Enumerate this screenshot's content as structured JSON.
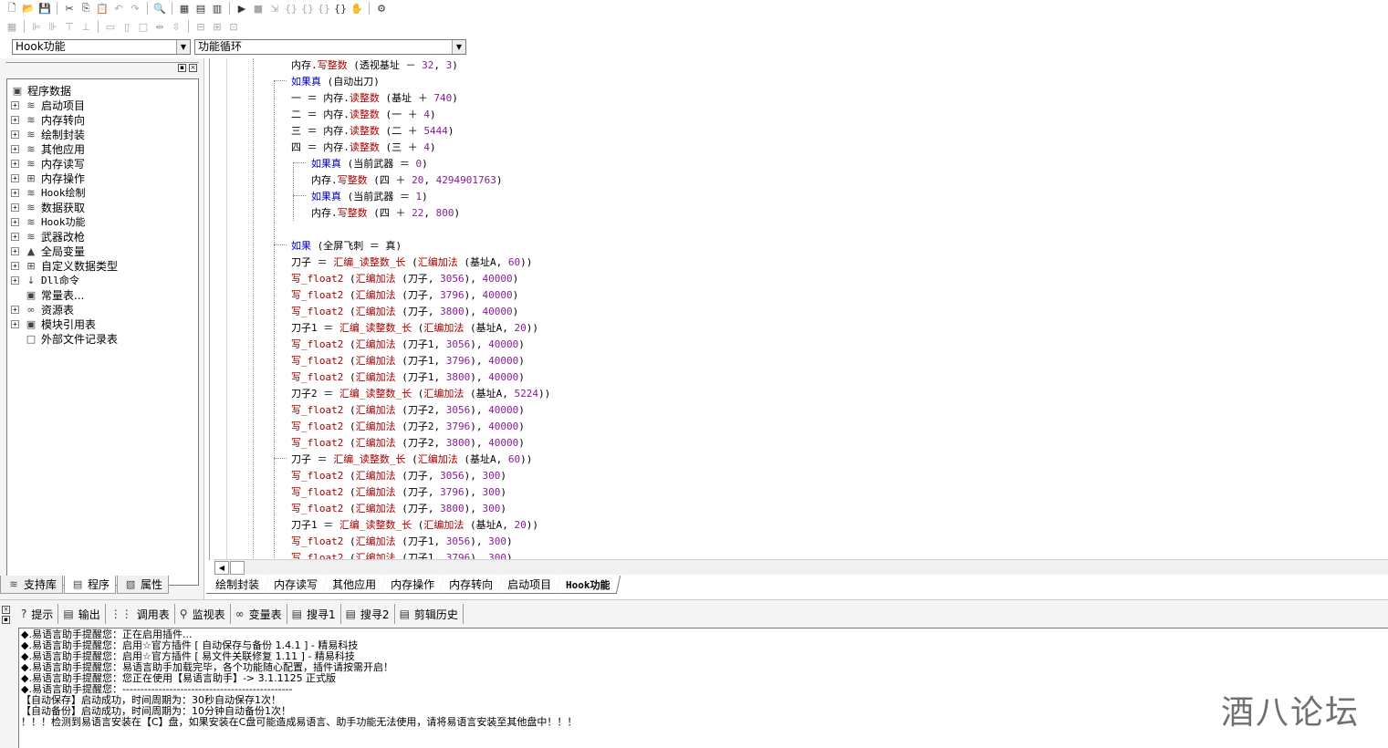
{
  "toolbar1": {
    "icons": [
      "new-file-icon",
      "open-folder-icon",
      "save-icon",
      "cut-icon",
      "copy-icon",
      "paste-icon",
      "undo-icon",
      "redo-icon",
      "find-icon",
      "layout1-icon",
      "layout2-icon",
      "layout3-icon",
      "run-icon",
      "stop-icon",
      "step-icon",
      "step-into-icon",
      "step-over-icon",
      "step-out-icon",
      "hand-icon",
      "plugin-icon"
    ]
  },
  "combos": {
    "left_value": "Hook功能",
    "right_value": "功能循环"
  },
  "tree": {
    "root": "程序数据",
    "items": [
      {
        "label": "启动项目",
        "expander": "+"
      },
      {
        "label": "内存转向",
        "expander": "+"
      },
      {
        "label": "绘制封装",
        "expander": "+"
      },
      {
        "label": "其他应用",
        "expander": "+"
      },
      {
        "label": "内存读写",
        "expander": "+"
      },
      {
        "label": "内存操作",
        "expander": "+"
      },
      {
        "label": "Hook绘制",
        "expander": "+"
      },
      {
        "label": "数据获取",
        "expander": "+"
      },
      {
        "label": "Hook功能",
        "expander": "+"
      },
      {
        "label": "武器改枪",
        "expander": "+"
      },
      {
        "label": "全局变量",
        "expander": "+"
      },
      {
        "label": "自定义数据类型",
        "expander": "+"
      },
      {
        "label": "Dll命令",
        "expander": "+"
      },
      {
        "label": "常量表...",
        "expander": ""
      },
      {
        "label": "资源表",
        "expander": "+"
      },
      {
        "label": "模块引用表",
        "expander": "+"
      },
      {
        "label": "外部文件记录表",
        "expander": ""
      }
    ]
  },
  "left_tabs": [
    {
      "label": "支持库"
    },
    {
      "label": "程序"
    },
    {
      "label": "属性"
    }
  ],
  "code": {
    "lines": [
      {
        "indent": 0,
        "parts": [
          [
            "var",
            "内存"
          ],
          [
            "var",
            "."
          ],
          [
            "fn",
            "写整数"
          ],
          [
            "var",
            " (透视基址 "
          ],
          [
            "var",
            "－"
          ],
          [
            "num",
            " 32"
          ],
          [
            "var",
            ", "
          ],
          [
            "num",
            "3"
          ],
          [
            "var",
            ")"
          ]
        ]
      },
      {
        "indent": 0,
        "parts": [
          [
            "kw",
            "如果真"
          ],
          [
            "var",
            " (自动出刀)"
          ]
        ]
      },
      {
        "indent": 0,
        "parts": [
          [
            "var",
            "一 "
          ],
          [
            "var",
            "＝"
          ],
          [
            "var",
            " 内存"
          ],
          [
            "var",
            "."
          ],
          [
            "fn",
            "读整数"
          ],
          [
            "var",
            " (基址 "
          ],
          [
            "var",
            "＋"
          ],
          [
            "num",
            " 740"
          ],
          [
            "var",
            ")"
          ]
        ]
      },
      {
        "indent": 0,
        "parts": [
          [
            "var",
            "二 "
          ],
          [
            "var",
            "＝"
          ],
          [
            "var",
            " 内存"
          ],
          [
            "var",
            "."
          ],
          [
            "fn",
            "读整数"
          ],
          [
            "var",
            " (一 "
          ],
          [
            "var",
            "＋"
          ],
          [
            "num",
            " 4"
          ],
          [
            "var",
            ")"
          ]
        ]
      },
      {
        "indent": 0,
        "parts": [
          [
            "var",
            "三 "
          ],
          [
            "var",
            "＝"
          ],
          [
            "var",
            " 内存"
          ],
          [
            "var",
            "."
          ],
          [
            "fn",
            "读整数"
          ],
          [
            "var",
            " (二 "
          ],
          [
            "var",
            "＋"
          ],
          [
            "num",
            " 5444"
          ],
          [
            "var",
            ")"
          ]
        ]
      },
      {
        "indent": 0,
        "parts": [
          [
            "var",
            "四 "
          ],
          [
            "var",
            "＝"
          ],
          [
            "var",
            " 内存"
          ],
          [
            "var",
            "."
          ],
          [
            "fn",
            "读整数"
          ],
          [
            "var",
            " (三 "
          ],
          [
            "var",
            "＋"
          ],
          [
            "num",
            " 4"
          ],
          [
            "var",
            ")"
          ]
        ]
      },
      {
        "indent": 1,
        "parts": [
          [
            "kw",
            "如果真"
          ],
          [
            "var",
            " (当前武器 "
          ],
          [
            "var",
            "＝"
          ],
          [
            "num",
            " 0"
          ],
          [
            "var",
            ")"
          ]
        ]
      },
      {
        "indent": 1,
        "parts": [
          [
            "var",
            "内存"
          ],
          [
            "var",
            "."
          ],
          [
            "fn",
            "写整数"
          ],
          [
            "var",
            " (四 "
          ],
          [
            "var",
            "＋"
          ],
          [
            "num",
            " 20"
          ],
          [
            "var",
            ", "
          ],
          [
            "num",
            "4294901763"
          ],
          [
            "var",
            ")"
          ]
        ]
      },
      {
        "indent": 1,
        "parts": [
          [
            "kw",
            "如果真"
          ],
          [
            "var",
            " (当前武器 "
          ],
          [
            "var",
            "＝"
          ],
          [
            "num",
            " 1"
          ],
          [
            "var",
            ")"
          ]
        ]
      },
      {
        "indent": 1,
        "parts": [
          [
            "var",
            "内存"
          ],
          [
            "var",
            "."
          ],
          [
            "fn",
            "写整数"
          ],
          [
            "var",
            " (四 "
          ],
          [
            "var",
            "＋"
          ],
          [
            "num",
            " 22"
          ],
          [
            "var",
            ", "
          ],
          [
            "num",
            "800"
          ],
          [
            "var",
            ")"
          ]
        ]
      },
      {
        "indent": 0,
        "parts": []
      },
      {
        "indent": 0,
        "parts": [
          [
            "kw",
            "如果"
          ],
          [
            "var",
            " (全屏飞刺 "
          ],
          [
            "var",
            "＝"
          ],
          [
            "var",
            " 真)"
          ]
        ]
      },
      {
        "indent": 0,
        "parts": [
          [
            "var",
            "刀子 "
          ],
          [
            "var",
            "＝"
          ],
          [
            "fn",
            " 汇编_读整数_长"
          ],
          [
            "var",
            " ("
          ],
          [
            "fn",
            "汇编加法"
          ],
          [
            "var",
            " (基址A, "
          ],
          [
            "num",
            "60"
          ],
          [
            "var",
            "))"
          ]
        ]
      },
      {
        "indent": 0,
        "parts": [
          [
            "fn",
            "写_float2"
          ],
          [
            "var",
            " ("
          ],
          [
            "fn",
            "汇编加法"
          ],
          [
            "var",
            " (刀子, "
          ],
          [
            "num",
            "3056"
          ],
          [
            "var",
            "), "
          ],
          [
            "num",
            "40000"
          ],
          [
            "var",
            ")"
          ]
        ]
      },
      {
        "indent": 0,
        "parts": [
          [
            "fn",
            "写_float2"
          ],
          [
            "var",
            " ("
          ],
          [
            "fn",
            "汇编加法"
          ],
          [
            "var",
            " (刀子, "
          ],
          [
            "num",
            "3796"
          ],
          [
            "var",
            "), "
          ],
          [
            "num",
            "40000"
          ],
          [
            "var",
            ")"
          ]
        ]
      },
      {
        "indent": 0,
        "parts": [
          [
            "fn",
            "写_float2"
          ],
          [
            "var",
            " ("
          ],
          [
            "fn",
            "汇编加法"
          ],
          [
            "var",
            " (刀子, "
          ],
          [
            "num",
            "3800"
          ],
          [
            "var",
            "), "
          ],
          [
            "num",
            "40000"
          ],
          [
            "var",
            ")"
          ]
        ]
      },
      {
        "indent": 0,
        "parts": [
          [
            "var",
            "刀子1 "
          ],
          [
            "var",
            "＝"
          ],
          [
            "fn",
            " 汇编_读整数_长"
          ],
          [
            "var",
            " ("
          ],
          [
            "fn",
            "汇编加法"
          ],
          [
            "var",
            " (基址A, "
          ],
          [
            "num",
            "20"
          ],
          [
            "var",
            "))"
          ]
        ]
      },
      {
        "indent": 0,
        "parts": [
          [
            "fn",
            "写_float2"
          ],
          [
            "var",
            " ("
          ],
          [
            "fn",
            "汇编加法"
          ],
          [
            "var",
            " (刀子1, "
          ],
          [
            "num",
            "3056"
          ],
          [
            "var",
            "), "
          ],
          [
            "num",
            "40000"
          ],
          [
            "var",
            ")"
          ]
        ]
      },
      {
        "indent": 0,
        "parts": [
          [
            "fn",
            "写_float2"
          ],
          [
            "var",
            " ("
          ],
          [
            "fn",
            "汇编加法"
          ],
          [
            "var",
            " (刀子1, "
          ],
          [
            "num",
            "3796"
          ],
          [
            "var",
            "), "
          ],
          [
            "num",
            "40000"
          ],
          [
            "var",
            ")"
          ]
        ]
      },
      {
        "indent": 0,
        "parts": [
          [
            "fn",
            "写_float2"
          ],
          [
            "var",
            " ("
          ],
          [
            "fn",
            "汇编加法"
          ],
          [
            "var",
            " (刀子1, "
          ],
          [
            "num",
            "3800"
          ],
          [
            "var",
            "), "
          ],
          [
            "num",
            "40000"
          ],
          [
            "var",
            ")"
          ]
        ]
      },
      {
        "indent": 0,
        "parts": [
          [
            "var",
            "刀子2 "
          ],
          [
            "var",
            "＝"
          ],
          [
            "fn",
            " 汇编_读整数_长"
          ],
          [
            "var",
            " ("
          ],
          [
            "fn",
            "汇编加法"
          ],
          [
            "var",
            " (基址A, "
          ],
          [
            "num",
            "5224"
          ],
          [
            "var",
            "))"
          ]
        ]
      },
      {
        "indent": 0,
        "parts": [
          [
            "fn",
            "写_float2"
          ],
          [
            "var",
            " ("
          ],
          [
            "fn",
            "汇编加法"
          ],
          [
            "var",
            " (刀子2, "
          ],
          [
            "num",
            "3056"
          ],
          [
            "var",
            "), "
          ],
          [
            "num",
            "40000"
          ],
          [
            "var",
            ")"
          ]
        ]
      },
      {
        "indent": 0,
        "parts": [
          [
            "fn",
            "写_float2"
          ],
          [
            "var",
            " ("
          ],
          [
            "fn",
            "汇编加法"
          ],
          [
            "var",
            " (刀子2, "
          ],
          [
            "num",
            "3796"
          ],
          [
            "var",
            "), "
          ],
          [
            "num",
            "40000"
          ],
          [
            "var",
            ")"
          ]
        ]
      },
      {
        "indent": 0,
        "parts": [
          [
            "fn",
            "写_float2"
          ],
          [
            "var",
            " ("
          ],
          [
            "fn",
            "汇编加法"
          ],
          [
            "var",
            " (刀子2, "
          ],
          [
            "num",
            "3800"
          ],
          [
            "var",
            "), "
          ],
          [
            "num",
            "40000"
          ],
          [
            "var",
            ")"
          ]
        ]
      },
      {
        "indent": 0,
        "parts": [
          [
            "var",
            "刀子 "
          ],
          [
            "var",
            "＝"
          ],
          [
            "fn",
            " 汇编_读整数_长"
          ],
          [
            "var",
            " ("
          ],
          [
            "fn",
            "汇编加法"
          ],
          [
            "var",
            " (基址A, "
          ],
          [
            "num",
            "60"
          ],
          [
            "var",
            "))"
          ]
        ]
      },
      {
        "indent": 0,
        "parts": [
          [
            "fn",
            "写_float2"
          ],
          [
            "var",
            " ("
          ],
          [
            "fn",
            "汇编加法"
          ],
          [
            "var",
            " (刀子, "
          ],
          [
            "num",
            "3056"
          ],
          [
            "var",
            "), "
          ],
          [
            "num",
            "300"
          ],
          [
            "var",
            ")"
          ]
        ]
      },
      {
        "indent": 0,
        "parts": [
          [
            "fn",
            "写_float2"
          ],
          [
            "var",
            " ("
          ],
          [
            "fn",
            "汇编加法"
          ],
          [
            "var",
            " (刀子, "
          ],
          [
            "num",
            "3796"
          ],
          [
            "var",
            "), "
          ],
          [
            "num",
            "300"
          ],
          [
            "var",
            ")"
          ]
        ]
      },
      {
        "indent": 0,
        "parts": [
          [
            "fn",
            "写_float2"
          ],
          [
            "var",
            " ("
          ],
          [
            "fn",
            "汇编加法"
          ],
          [
            "var",
            " (刀子, "
          ],
          [
            "num",
            "3800"
          ],
          [
            "var",
            "), "
          ],
          [
            "num",
            "300"
          ],
          [
            "var",
            ")"
          ]
        ]
      },
      {
        "indent": 0,
        "parts": [
          [
            "var",
            "刀子1 "
          ],
          [
            "var",
            "＝"
          ],
          [
            "fn",
            " 汇编_读整数_长"
          ],
          [
            "var",
            " ("
          ],
          [
            "fn",
            "汇编加法"
          ],
          [
            "var",
            " (基址A, "
          ],
          [
            "num",
            "20"
          ],
          [
            "var",
            "))"
          ]
        ]
      },
      {
        "indent": 0,
        "parts": [
          [
            "fn",
            "写_float2"
          ],
          [
            "var",
            " ("
          ],
          [
            "fn",
            "汇编加法"
          ],
          [
            "var",
            " (刀子1, "
          ],
          [
            "num",
            "3056"
          ],
          [
            "var",
            "), "
          ],
          [
            "num",
            "300"
          ],
          [
            "var",
            ")"
          ]
        ]
      },
      {
        "indent": 0,
        "parts": [
          [
            "fn",
            "写_float2"
          ],
          [
            "var",
            " ("
          ],
          [
            "fn",
            "汇编加法"
          ],
          [
            "var",
            " (刀子1, "
          ],
          [
            "num",
            "3796"
          ],
          [
            "var",
            "), "
          ],
          [
            "num",
            "300"
          ],
          [
            "var",
            ")"
          ]
        ]
      }
    ]
  },
  "editor_tabs": [
    {
      "label": "绘制封装",
      "active": false
    },
    {
      "label": "内存读写",
      "active": false
    },
    {
      "label": "其他应用",
      "active": false
    },
    {
      "label": "内存操作",
      "active": false
    },
    {
      "label": "内存转向",
      "active": false
    },
    {
      "label": "启动项目",
      "active": false
    },
    {
      "label": "Hook功能",
      "active": true
    }
  ],
  "bottom_tabs": [
    {
      "label": "提示",
      "icon": "?"
    },
    {
      "label": "输出",
      "icon": "▤"
    },
    {
      "label": "调用表",
      "icon": "⋮⋮"
    },
    {
      "label": "监视表",
      "icon": "⚲"
    },
    {
      "label": "变量表",
      "icon": "∞"
    },
    {
      "label": "搜寻1",
      "icon": "▤"
    },
    {
      "label": "搜寻2",
      "icon": "▤"
    },
    {
      "label": "剪辑历史",
      "icon": "▤"
    }
  ],
  "output_lines": [
    "◆.易语言助手提醒您：正在启用插件...",
    "◆.易语言助手提醒您：启用☆官方插件 [ 自动保存与备份 1.4.1 ] - 精易科技",
    "◆.易语言助手提醒您：启用☆官方插件 [ 易文件关联修复 1.11 ] - 精易科技",
    "◆.易语言助手提醒您：易语言助手加载完毕，各个功能随心配置，插件请按需开启！",
    "◆.易语言助手提醒您：您正在使用【易语言助手】-> 3.1.1125 正式版",
    "◆.易语言助手提醒您：-----------------------------------------------",
    "【自动保存】启动成功，时间周期为：30秒自动保存1次！",
    "【自动备份】启动成功，时间周期为：10分钟自动备份1次！",
    "！！！检测到易语言安装在【C】盘，如果安装在C盘可能造成易语言、助手功能无法使用，请将易语言安装至其他盘中！！！"
  ],
  "watermark": "酒八论坛"
}
